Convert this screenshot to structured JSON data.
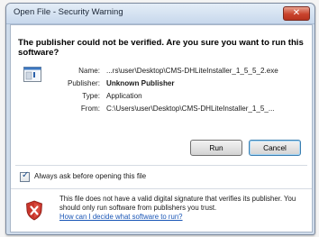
{
  "window": {
    "title": "Open File - Security Warning",
    "close_label": "✕"
  },
  "headline": "The publisher could not be verified.  Are you sure you want to run this software?",
  "details": {
    "name_label": "Name:",
    "name_value": "...rs\\user\\Desktop\\CMS-DHLiteInstaller_1_5_5_2.exe",
    "publisher_label": "Publisher:",
    "publisher_value": "Unknown Publisher",
    "type_label": "Type:",
    "type_value": "Application",
    "from_label": "From:",
    "from_value": "C:\\Users\\user\\Desktop\\CMS-DHLiteInstaller_1_5_..."
  },
  "buttons": {
    "run_label": "Run",
    "cancel_label": "Cancel"
  },
  "checkbox": {
    "label": "Always ask before opening this file",
    "checked": true
  },
  "warning": {
    "text": "This file does not have a valid digital signature that verifies its publisher.  You should only run software from publishers you trust.",
    "link_text": "How can I decide what software to run?"
  },
  "icons": {
    "file": "application-file-icon",
    "shield": "security-shield-warning-icon",
    "check": "checkmark-icon"
  },
  "colors": {
    "link": "#1a56b6",
    "close_button": "#c9432d",
    "title_bar": "#c7d8ec"
  }
}
